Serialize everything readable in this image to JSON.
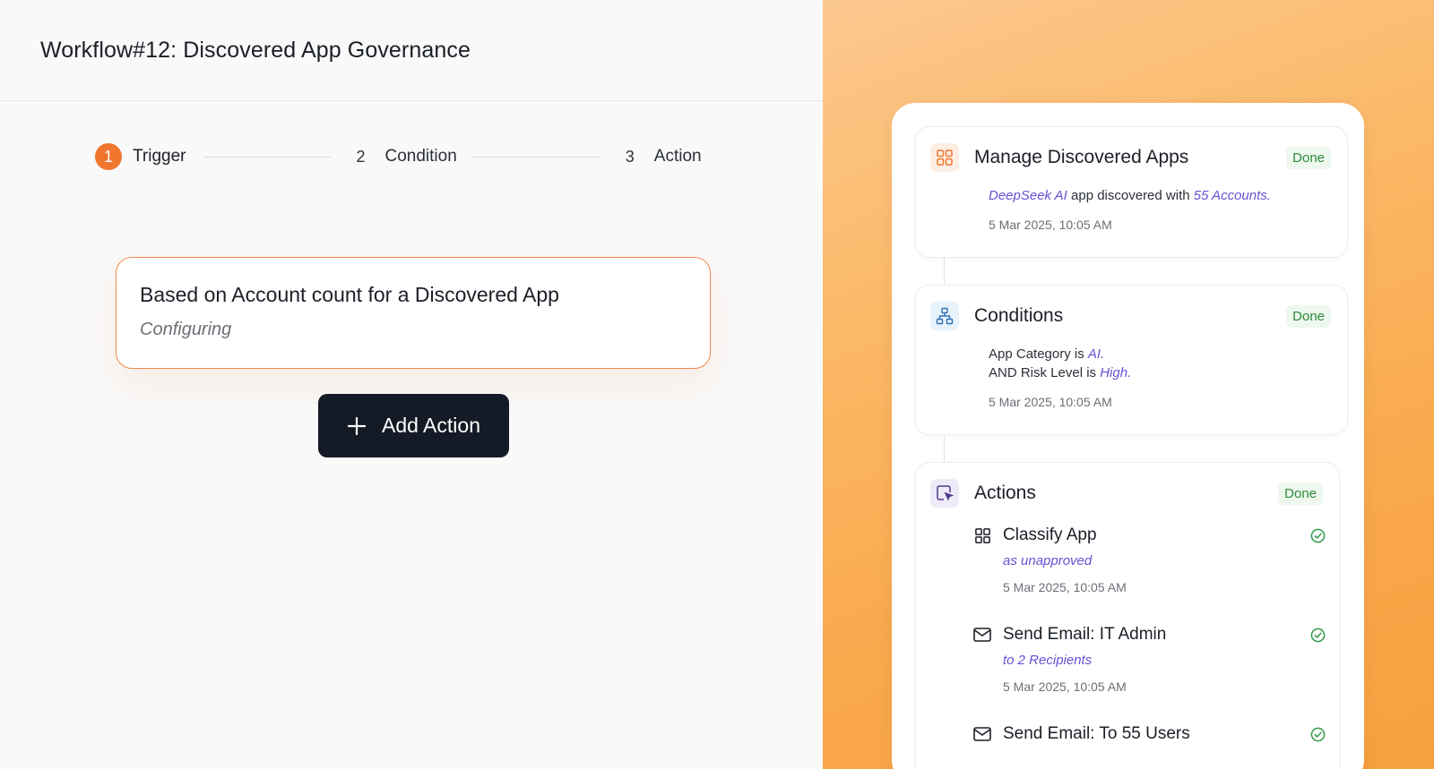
{
  "page_title": "Workflow#12: Discovered App Governance",
  "stepper": {
    "steps": [
      {
        "num": "1",
        "label": "Trigger"
      },
      {
        "num": "2",
        "label": "Condition"
      },
      {
        "num": "3",
        "label": "Action"
      }
    ]
  },
  "trigger_card": {
    "title": "Based on Account count for a Discovered App",
    "status": "Configuring"
  },
  "add_action_label": "Add Action",
  "colors": {
    "accent_orange": "#f0762d",
    "highlight_purple": "#6a4fd6",
    "done_green": "#2f8a3c",
    "button_dark": "#151b26"
  },
  "summary": {
    "manage": {
      "title": "Manage Discovered Apps",
      "badge": "Done",
      "app_name": "DeepSeek AI",
      "text_mid": " app discovered with ",
      "accounts": "55 Accounts",
      "dot": ".",
      "timestamp": "5 Mar 2025, 10:05 AM"
    },
    "conditions": {
      "title": "Conditions",
      "badge": "Done",
      "line1_prefix": "App Category is ",
      "line1_value": "AI",
      "line2_prefix": "AND Risk Level is ",
      "line2_value": "High",
      "dot": ".",
      "timestamp": "5 Mar 2025, 10:05 AM"
    },
    "actions": {
      "title": "Actions",
      "badge": "Done",
      "items": [
        {
          "icon": "grid-icon",
          "title": "Classify App",
          "detail": "as unapproved",
          "timestamp": "5 Mar 2025, 10:05 AM"
        },
        {
          "icon": "mail-icon",
          "title": "Send Email: IT Admin",
          "detail": "to 2 Recipients",
          "timestamp": "5 Mar 2025, 10:05 AM"
        },
        {
          "icon": "mail-icon",
          "title": "Send Email: To 55 Users"
        }
      ]
    }
  }
}
